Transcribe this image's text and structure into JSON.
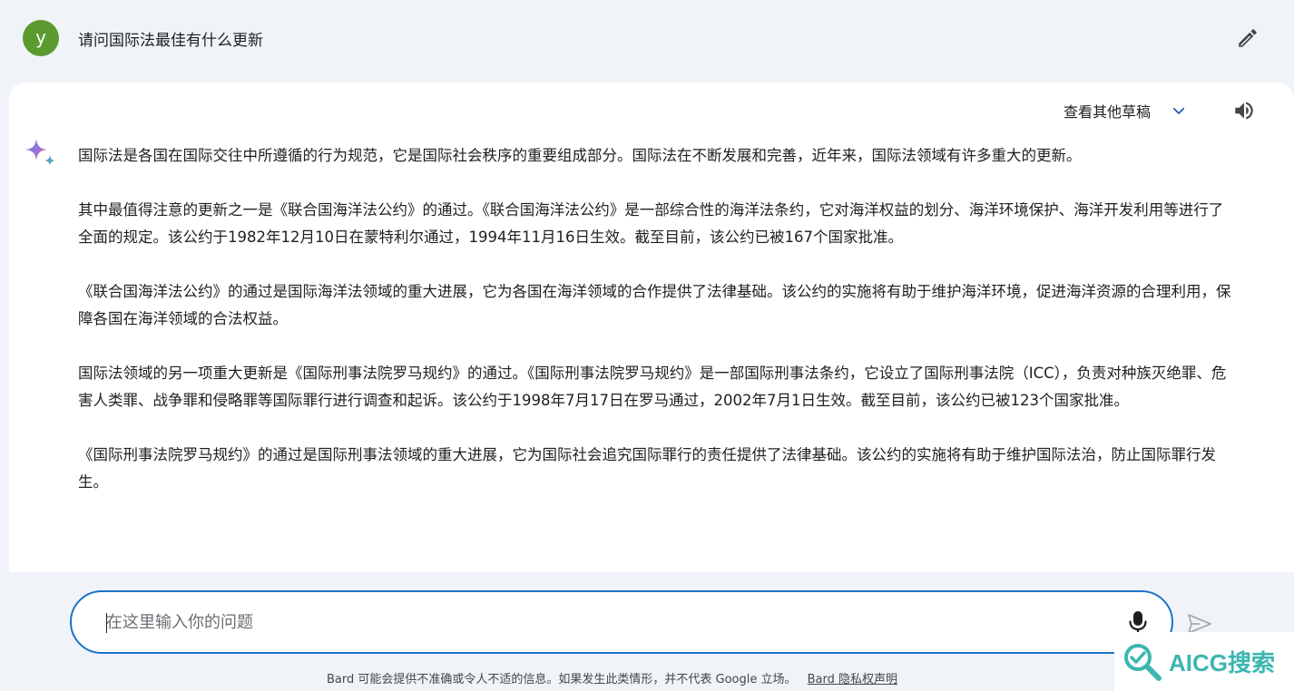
{
  "prompt": {
    "avatar_letter": "y",
    "text": "请问国际法最佳有什么更新"
  },
  "response": {
    "view_drafts_label": "查看其他草稿",
    "paragraphs": [
      "国际法是各国在国际交往中所遵循的行为规范，它是国际社会秩序的重要组成部分。国际法在不断发展和完善，近年来，国际法领域有许多重大的更新。",
      "其中最值得注意的更新之一是《联合国海洋法公约》的通过。《联合国海洋法公约》是一部综合性的海洋法条约，它对海洋权益的划分、海洋环境保护、海洋开发利用等进行了全面的规定。该公约于1982年12月10日在蒙特利尔通过，1994年11月16日生效。截至目前，该公约已被167个国家批准。",
      "《联合国海洋法公约》的通过是国际海洋法领域的重大进展，它为各国在海洋领域的合作提供了法律基础。该公约的实施将有助于维护海洋环境，促进海洋资源的合理利用，保障各国在海洋领域的合法权益。",
      "国际法领域的另一项重大更新是《国际刑事法院罗马规约》的通过。《国际刑事法院罗马规约》是一部国际刑事法条约，它设立了国际刑事法院（ICC），负责对种族灭绝罪、危害人类罪、战争罪和侵略罪等国际罪行进行调查和起诉。该公约于1998年7月17日在罗马通过，2002年7月1日生效。截至目前，该公约已被123个国家批准。",
      "《国际刑事法院罗马规约》的通过是国际刑事法领域的重大进展，它为国际社会追究国际罪行的责任提供了法律基础。该公约的实施将有助于维护国际法治，防止国际罪行发生。"
    ]
  },
  "input": {
    "placeholder": "在这里输入你的问题",
    "value": ""
  },
  "footer": {
    "disclaimer": "Bard 可能会提供不准确或令人不适的信息。如果发生此类情形，并不代表 Google 立场。",
    "privacy_link": "Bard 隐私权声明"
  },
  "watermark": {
    "text": "AICG搜索"
  },
  "colors": {
    "background": "#f0f4f9",
    "card": "#ffffff",
    "accent": "#1a73c8",
    "avatar": "#5b9a2f",
    "watermark": "#3cb6b0"
  },
  "icons": [
    "edit-pencil-icon",
    "chevron-down-icon",
    "speaker-icon",
    "bard-sparkle-icon",
    "microphone-icon",
    "send-icon",
    "search-logo-icon"
  ]
}
